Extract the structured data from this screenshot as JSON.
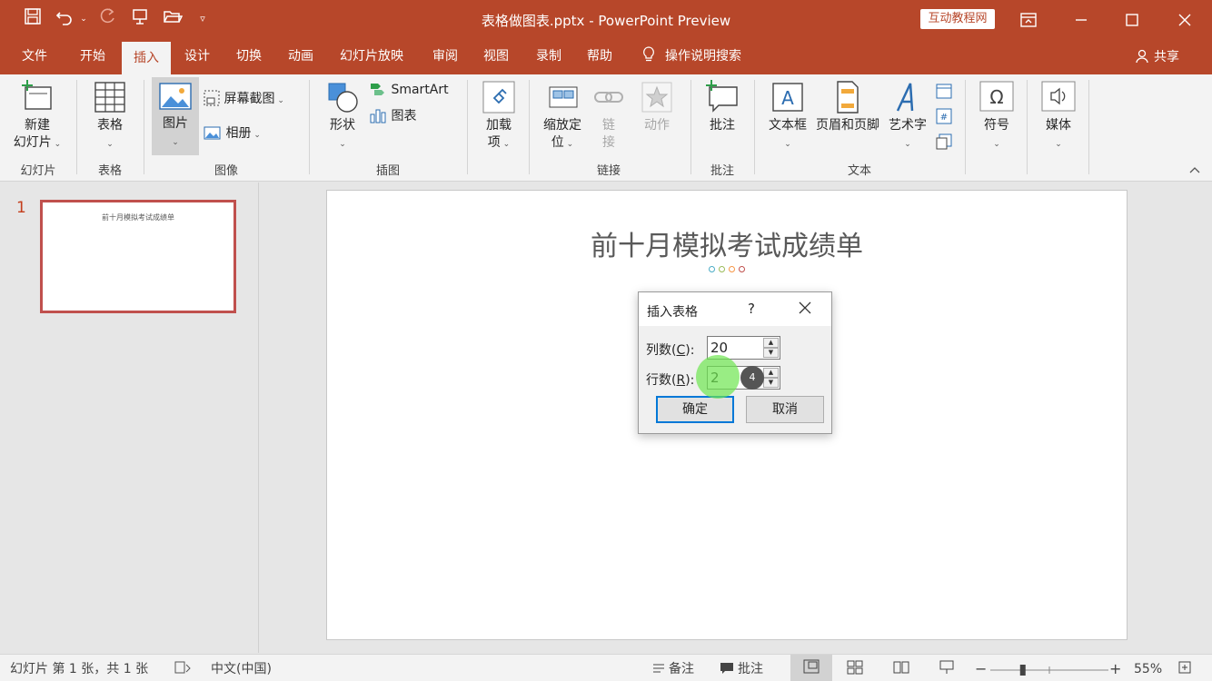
{
  "window": {
    "title": "表格做图表.pptx  -  PowerPoint Preview",
    "badge": "互动教程网"
  },
  "menu": {
    "tabs": [
      "文件",
      "开始",
      "插入",
      "设计",
      "切换",
      "动画",
      "幻灯片放映",
      "审阅",
      "视图",
      "录制",
      "帮助"
    ],
    "active_tab": "插入",
    "search": "操作说明搜索",
    "share": "共享"
  },
  "ribbon": {
    "groups": {
      "slides": "幻灯片",
      "tables": "表格",
      "images": "图像",
      "illustrations": "插图",
      "links": "链接",
      "comments": "批注",
      "text": "文本"
    },
    "buttons": {
      "new_slide_1": "新建",
      "new_slide_2": "幻灯片",
      "table": "表格",
      "picture": "图片",
      "screenshot": "屏幕截图",
      "album": "相册",
      "shapes": "形状",
      "smartart": "SmartArt",
      "chart": "图表",
      "addins_1": "加载",
      "addins_2": "项",
      "zoom_1": "缩放定",
      "zoom_2": "位",
      "link_1": "链",
      "link_2": "接",
      "action": "动作",
      "comment": "批注",
      "textbox": "文本框",
      "header_footer": "页眉和页脚",
      "wordart": "艺术字",
      "symbol": "符号",
      "media": "媒体"
    }
  },
  "slides_panel": {
    "slide_number": "1",
    "thumb_title": "前十月模拟考试成绩单"
  },
  "slide": {
    "title": "前十月模拟考试成绩单",
    "dot_colors": [
      "#4bacc6",
      "#9bbb59",
      "#f79646",
      "#c0504d"
    ]
  },
  "dialog": {
    "title": "插入表格",
    "help": "?",
    "columns_label_pre": "列数(",
    "columns_label_key": "C",
    "columns_label_post": "):",
    "columns_value": "20",
    "rows_label_pre": "行数(",
    "rows_label_key": "R",
    "rows_label_post": "):",
    "rows_value": "2",
    "ok": "确定",
    "cancel": "取消",
    "step_badge": "4"
  },
  "status": {
    "slide_info": "幻灯片 第 1 张，共 1 张",
    "language": "中文(中国)",
    "notes": "备注",
    "comments": "批注",
    "zoom": "55%",
    "zoom_fraction": 0.55
  }
}
